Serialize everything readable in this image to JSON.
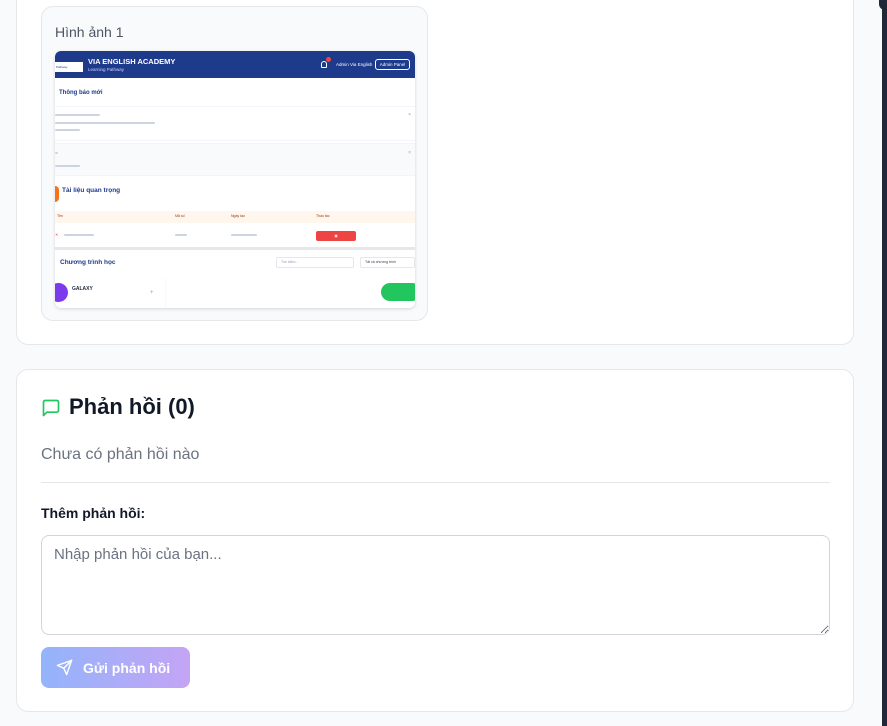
{
  "image_gallery": {
    "label": "Hình ảnh 1",
    "thumbnail": {
      "app_title": "VIA ENGLISH ACADEMY",
      "app_subtitle": "Learning Pathway",
      "logo_text": "Pathway",
      "user_name": "Admin Via English",
      "admin_button": "Admin Panel",
      "notices_title": "Thông báo mới",
      "docs_title": "Tài liệu quan trọng",
      "table_headers": [
        "Tên",
        "Mã số",
        "Ngày tạo",
        "Thao tác"
      ],
      "programs_title": "Chương trình học",
      "search_placeholder": "Tìm kiếm...",
      "filter_label": "Tất cả chương trình",
      "course_name": "GALAXY"
    }
  },
  "feedback": {
    "title": "Phản hồi (0)",
    "empty_text": "Chưa có phản hồi nào",
    "add_label": "Thêm phản hồi:",
    "textarea_placeholder": "Nhập phản hồi của bạn...",
    "textarea_value": "",
    "send_button": "Gửi phản hồi",
    "accent_color": "#22c55e",
    "button_gradient": [
      "#93b4fb",
      "#c4a4f5"
    ]
  }
}
